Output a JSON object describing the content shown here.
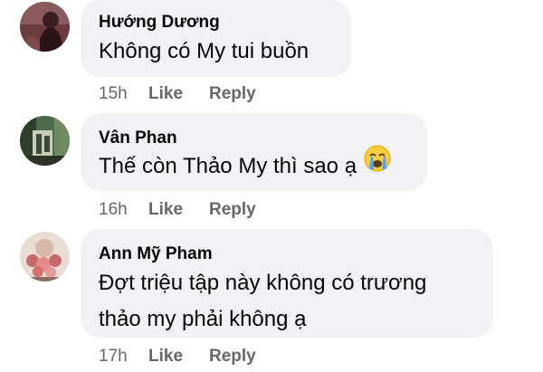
{
  "comments": [
    {
      "author": "Hướng Dương",
      "text": "Không có My tui buồn",
      "time": "15h",
      "like": "Like",
      "reply": "Reply",
      "avatar_icon": "profile-photo-dark"
    },
    {
      "author": "Vân Phan",
      "text": "Thế còn Thảo My thì sao ạ",
      "emoji": "crying-face-emoji",
      "time": "16h",
      "like": "Like",
      "reply": "Reply",
      "avatar_icon": "profile-photo-green"
    },
    {
      "author": "Ann Mỹ Pham",
      "text_lines": [
        "Đợt triệu tập này không có trương",
        "thảo my phải không ạ"
      ],
      "time": "17h",
      "like": "Like",
      "reply": "Reply",
      "avatar_icon": "profile-photo-flowers"
    }
  ],
  "colors": {
    "bubble": "#f0f2f5",
    "text": "#050505",
    "meta": "#65676b"
  }
}
